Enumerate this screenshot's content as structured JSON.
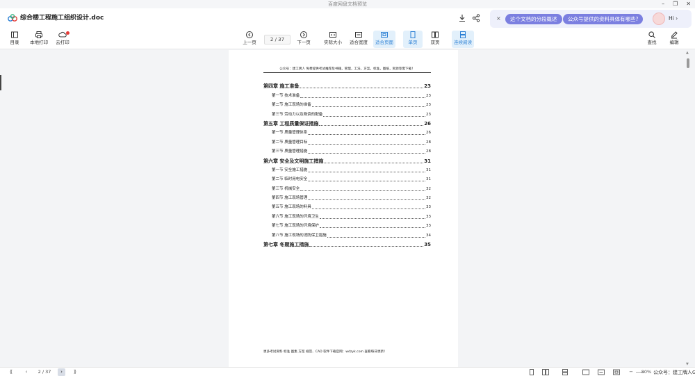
{
  "window": {
    "title": "百度网盘文档预览",
    "controls": [
      "–",
      "❐",
      "✕"
    ]
  },
  "header": {
    "doc_title": "综合楼工程施工组织设计.doc",
    "icons": {
      "download": "download-icon",
      "share": "share-icon"
    },
    "ai": {
      "close": "×",
      "chips": [
        "这个文档的分段概述",
        "公众号提供的资料具体有哪些?"
      ],
      "hi_label": "Hi",
      "hi_caret": "›"
    }
  },
  "toolbar": {
    "directory": "目录",
    "local_print": "本地打印",
    "cloud_print": "云打印",
    "prev_page": "上一页",
    "page_indicator": "2 / 37",
    "next_page": "下一页",
    "actual_size": "实际大小",
    "fit_width": "适合宽度",
    "fit_page": "适合页面",
    "single_page": "单页",
    "double_page": "双页",
    "continuous": "连续阅读",
    "search": "查找",
    "edit": "编辑"
  },
  "document": {
    "header_text": "公众号：建工牌人 免费提供考试推荐及书籍，管理，工法，方案，标准，图纸，资源等需下载！",
    "toc": [
      {
        "level": "chapter",
        "text": "第四章  施工准备",
        "page": "23"
      },
      {
        "level": "section",
        "text": "第一节  技术准备",
        "page": "23"
      },
      {
        "level": "section",
        "text": "第二节  施工现场的准备",
        "page": "23"
      },
      {
        "level": "section",
        "text": "第三节  劳动力以及物资的配备",
        "page": "23"
      },
      {
        "level": "chapter",
        "text": "第五章  工程质量保证措施",
        "page": "26"
      },
      {
        "level": "section",
        "text": "第一节  质量管理体系",
        "page": "26"
      },
      {
        "level": "section",
        "text": "第二节  质量管理目标",
        "page": "28"
      },
      {
        "level": "section",
        "text": "第三节  质量管理措施",
        "page": "28"
      },
      {
        "level": "chapter",
        "text": "第六章  安全及文明施工措施",
        "page": "31"
      },
      {
        "level": "section",
        "text": "第一节  安全施工措施",
        "page": "31"
      },
      {
        "level": "section",
        "text": "第二节  临时用电安全",
        "page": "31"
      },
      {
        "level": "section",
        "text": "第三节  机械安全",
        "page": "32"
      },
      {
        "level": "section",
        "text": "第四节  施工现场管理",
        "page": "32"
      },
      {
        "level": "section",
        "text": "第五节  施工现场的料具",
        "page": "33"
      },
      {
        "level": "section",
        "text": "第六节  施工现场的环境卫生",
        "page": "33"
      },
      {
        "level": "section",
        "text": "第七节  施工现场的环境保护",
        "page": "33"
      },
      {
        "level": "section",
        "text": "第八节  施工现场的消防保卫措施",
        "page": "34"
      },
      {
        "level": "chapter",
        "text": "第七章  冬期施工措施",
        "page": "35"
      }
    ],
    "footer_text": "更多考试资料 标准 图集 方案 规范、CAD 软件下载官网：wdzyk.com 查看每日更新！"
  },
  "bottombar": {
    "first": "⟪",
    "prev": "‹",
    "page_indicator": "2 / 37",
    "next": "›",
    "last": "⟫",
    "zoom_out": "−",
    "zoom_level": "80%",
    "zoom_in": "+",
    "watermark": "公众号：建工牌人Gc"
  },
  "colors": {
    "accent": "#2a7fd4",
    "ai_chip": "#7b7fe0",
    "ai_bar_bg": "#eef0fb",
    "badge": "#e53935"
  }
}
